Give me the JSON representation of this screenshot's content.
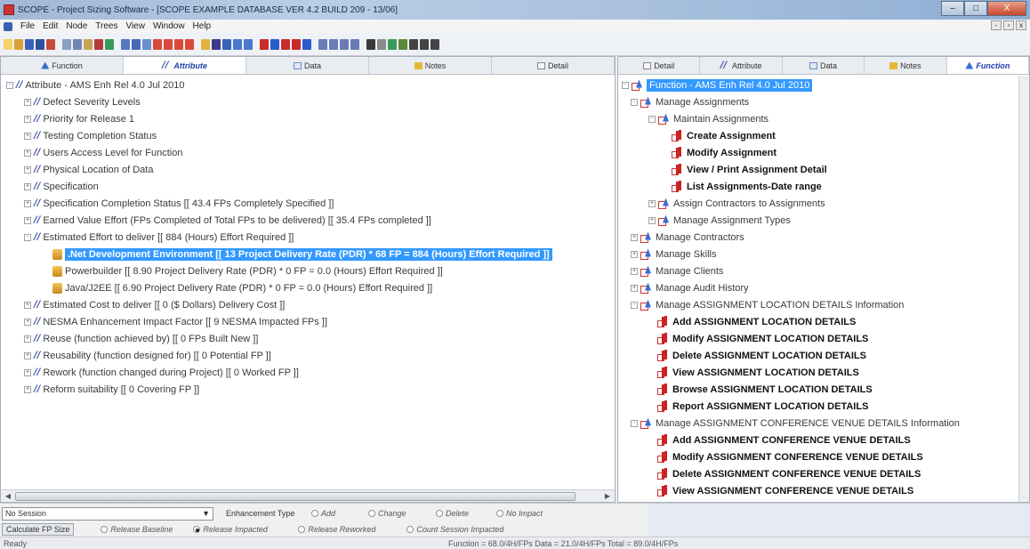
{
  "window": {
    "title": "SCOPE - Project Sizing Software - [SCOPE EXAMPLE DATABASE VER 4.2 BUILD 209 - 13/06]",
    "min": "–",
    "max": "□",
    "close": "X"
  },
  "menu": [
    "File",
    "Edit",
    "Node",
    "Trees",
    "View",
    "Window",
    "Help"
  ],
  "left_tabs": [
    "Function",
    "Attribute",
    "Data",
    "Notes",
    "Detail"
  ],
  "right_tabs": [
    "Detail",
    "Attribute",
    "Data",
    "Notes",
    "Function"
  ],
  "left_tree": {
    "root": "Attribute - AMS Enh Rel 4.0 Jul 2010",
    "items": [
      "Defect Severity Levels",
      "Priority for Release 1",
      "Testing Completion Status",
      "Users Access Level for Function",
      "Physical Location of Data",
      "Specification",
      "Specification Completion Status   [[ 43.4  FPs Completely Specified ]]",
      "Earned Value Effort  (FPs Completed of Total FPs to be delivered)   [[ 35.4  FPs completed ]]",
      "Estimated Effort to deliver   [[ 884  (Hours)  Effort Required ]]"
    ],
    "children": [
      ".Net Development Environment   [[ 13 Project Delivery Rate (PDR) * 68 FP = 884 (Hours)  Effort Required ]]",
      "Powerbuilder   [[ 8.90 Project Delivery Rate (PDR) * 0 FP = 0.0 (Hours)  Effort Required ]]",
      "Java/J2EE   [[ 6.90 Project Delivery Rate (PDR) * 0 FP = 0.0 (Hours)  Effort Required ]]"
    ],
    "items_after": [
      "Estimated Cost to deliver   [[ 0  ($ Dollars) Delivery Cost ]]",
      "NESMA Enhancement Impact Factor   [[ 9  NESMA Impacted FPs ]]",
      "Reuse (function achieved by)   [[ 0  FPs Built New ]]",
      "Reusability (function designed for)   [[ 0  Potential FP ]]",
      "Rework (function changed during Project)   [[ 0  Worked FP ]]",
      "Reform suitability   [[ 0  Covering FP ]]"
    ]
  },
  "right_tree": {
    "root": "Function - AMS Enh Rel 4.0 Jul 2010",
    "manage_assignments": "Manage Assignments",
    "maintain_assignments": "Maintain Assignments",
    "maintain_children": [
      "Create Assignment",
      "Modify Assignment",
      "View / Print Assignment Detail",
      "List Assignments-Date range"
    ],
    "assign_contractors": "Assign Contractors to Assignments",
    "manage_assignment_types": "Manage Assignment Types",
    "groups": [
      "Manage Contractors",
      "Manage Skills",
      "Manage Clients",
      "Manage Audit History"
    ],
    "location_group": "Manage ASSIGNMENT LOCATION DETAILS Information",
    "location_children": [
      "Add ASSIGNMENT LOCATION DETAILS",
      "Modify ASSIGNMENT LOCATION DETAILS",
      "Delete ASSIGNMENT LOCATION DETAILS",
      "View ASSIGNMENT LOCATION DETAILS",
      "Browse ASSIGNMENT LOCATION DETAILS",
      "Report ASSIGNMENT LOCATION DETAILS"
    ],
    "venue_group": "Manage ASSIGNMENT CONFERENCE VENUE DETAILS Information",
    "venue_children": [
      "Add ASSIGNMENT CONFERENCE VENUE DETAILS",
      "Modify ASSIGNMENT CONFERENCE VENUE DETAILS",
      "Delete ASSIGNMENT CONFERENCE VENUE DETAILS",
      "View ASSIGNMENT CONFERENCE VENUE DETAILS"
    ]
  },
  "bottom": {
    "session_value": "No Session",
    "enhancement_label": "Enhancement Type",
    "enh_options": [
      "Add",
      "Change",
      "Delete",
      "No Impact"
    ],
    "calc_button": "Calculate FP Size",
    "release_options": [
      "Release Baseline",
      "Release Impacted",
      "Release Reworked",
      "Count Session Impacted"
    ]
  },
  "status": {
    "left": "Ready",
    "right": "Function = 68.0/4H/FPs  Data = 21.0/4H/FPs  Total = 89.0/4H/FPs"
  },
  "colors": {
    "selection": "#3399ff",
    "attribute_icon": "#2a3f9a",
    "leaf_flag": "#cc2222"
  }
}
